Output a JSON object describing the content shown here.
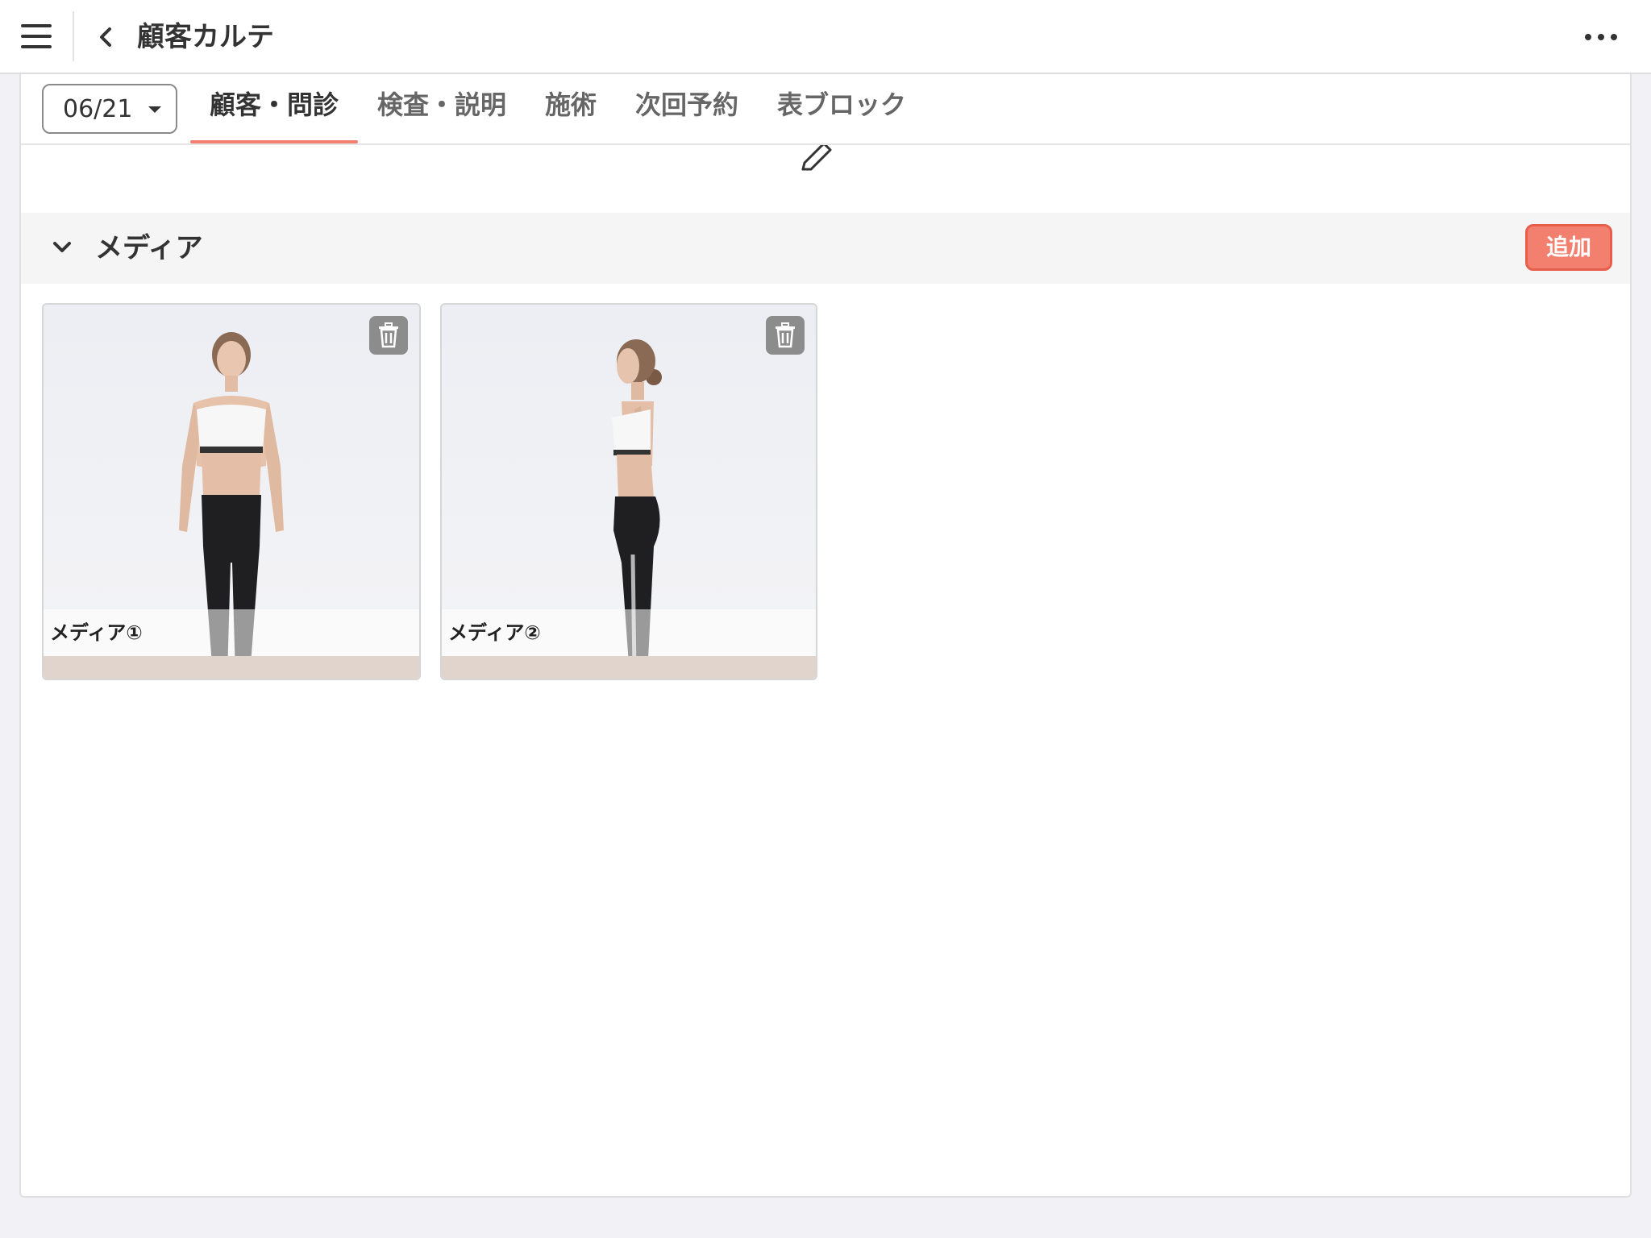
{
  "header": {
    "title": "顧客カルテ"
  },
  "tabbar": {
    "date_value": "06/21",
    "tabs": [
      {
        "label": "顧客・問診",
        "active": true
      },
      {
        "label": "検査・説明",
        "active": false
      },
      {
        "label": "施術",
        "active": false
      },
      {
        "label": "次回予約",
        "active": false
      },
      {
        "label": "表ブロック",
        "active": false
      }
    ]
  },
  "media_section": {
    "title": "メディア",
    "add_label": "追加",
    "items": [
      {
        "label": "メディア①"
      },
      {
        "label": "メディア②"
      }
    ]
  },
  "colors": {
    "accent": "#f37f6e",
    "accent_border": "#e85e4c",
    "section_bg": "#f5f5f5",
    "page_bg": "#f2f2f6"
  }
}
